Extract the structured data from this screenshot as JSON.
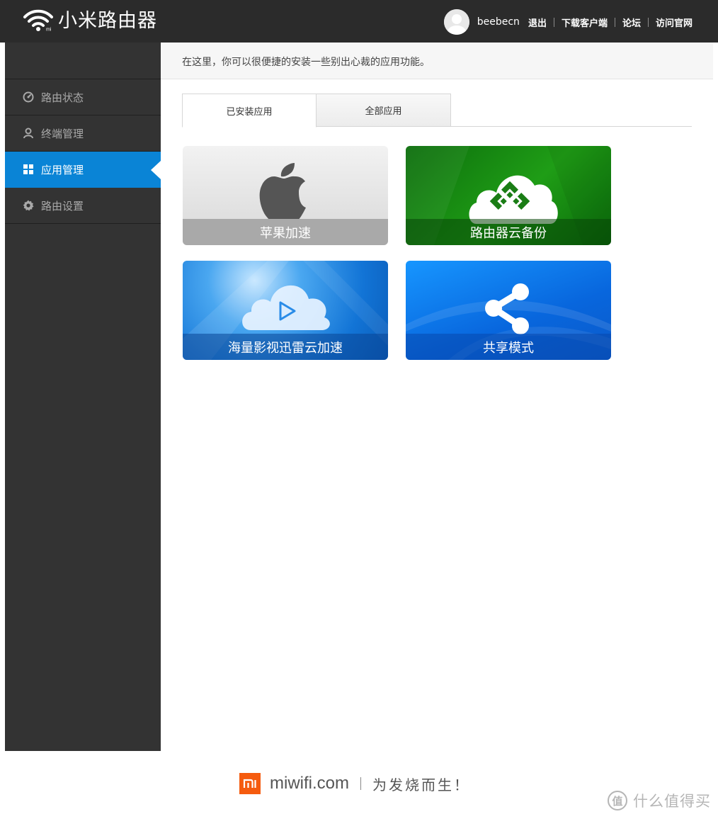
{
  "header": {
    "brand": "小米路由器",
    "username": "beebecn",
    "links": [
      "退出",
      "下载客户端",
      "论坛",
      "访问官网"
    ]
  },
  "sidebar": {
    "items": [
      {
        "label": "路由状态",
        "icon": "gauge-icon",
        "active": false
      },
      {
        "label": "终端管理",
        "icon": "person-icon",
        "active": false
      },
      {
        "label": "应用管理",
        "icon": "grid-icon",
        "active": true
      },
      {
        "label": "路由设置",
        "icon": "gear-icon",
        "active": false
      }
    ]
  },
  "main": {
    "notice": "在这里，你可以很便捷的安装一些别出心裁的应用功能。",
    "tabs": [
      {
        "label": "已安装应用",
        "active": true
      },
      {
        "label": "全部应用",
        "active": false
      }
    ],
    "apps": [
      {
        "label": "苹果加速",
        "icon": "apple-icon"
      },
      {
        "label": "路由器云备份",
        "icon": "cloud-backup-icon"
      },
      {
        "label": "海量影视迅雷云加速",
        "icon": "cloud-play-icon"
      },
      {
        "label": "共享模式",
        "icon": "share-icon"
      }
    ]
  },
  "footer": {
    "logo_text": "mi",
    "domain": "miwifi.com",
    "slogan": "为发烧而生！"
  },
  "watermark": {
    "symbol": "值",
    "text": "什么值得买"
  },
  "colors": {
    "header_bg": "#2b2b2b",
    "sidebar_bg": "#333333",
    "active_blue": "#0a84d6",
    "mi_orange": "#f55b0e"
  }
}
